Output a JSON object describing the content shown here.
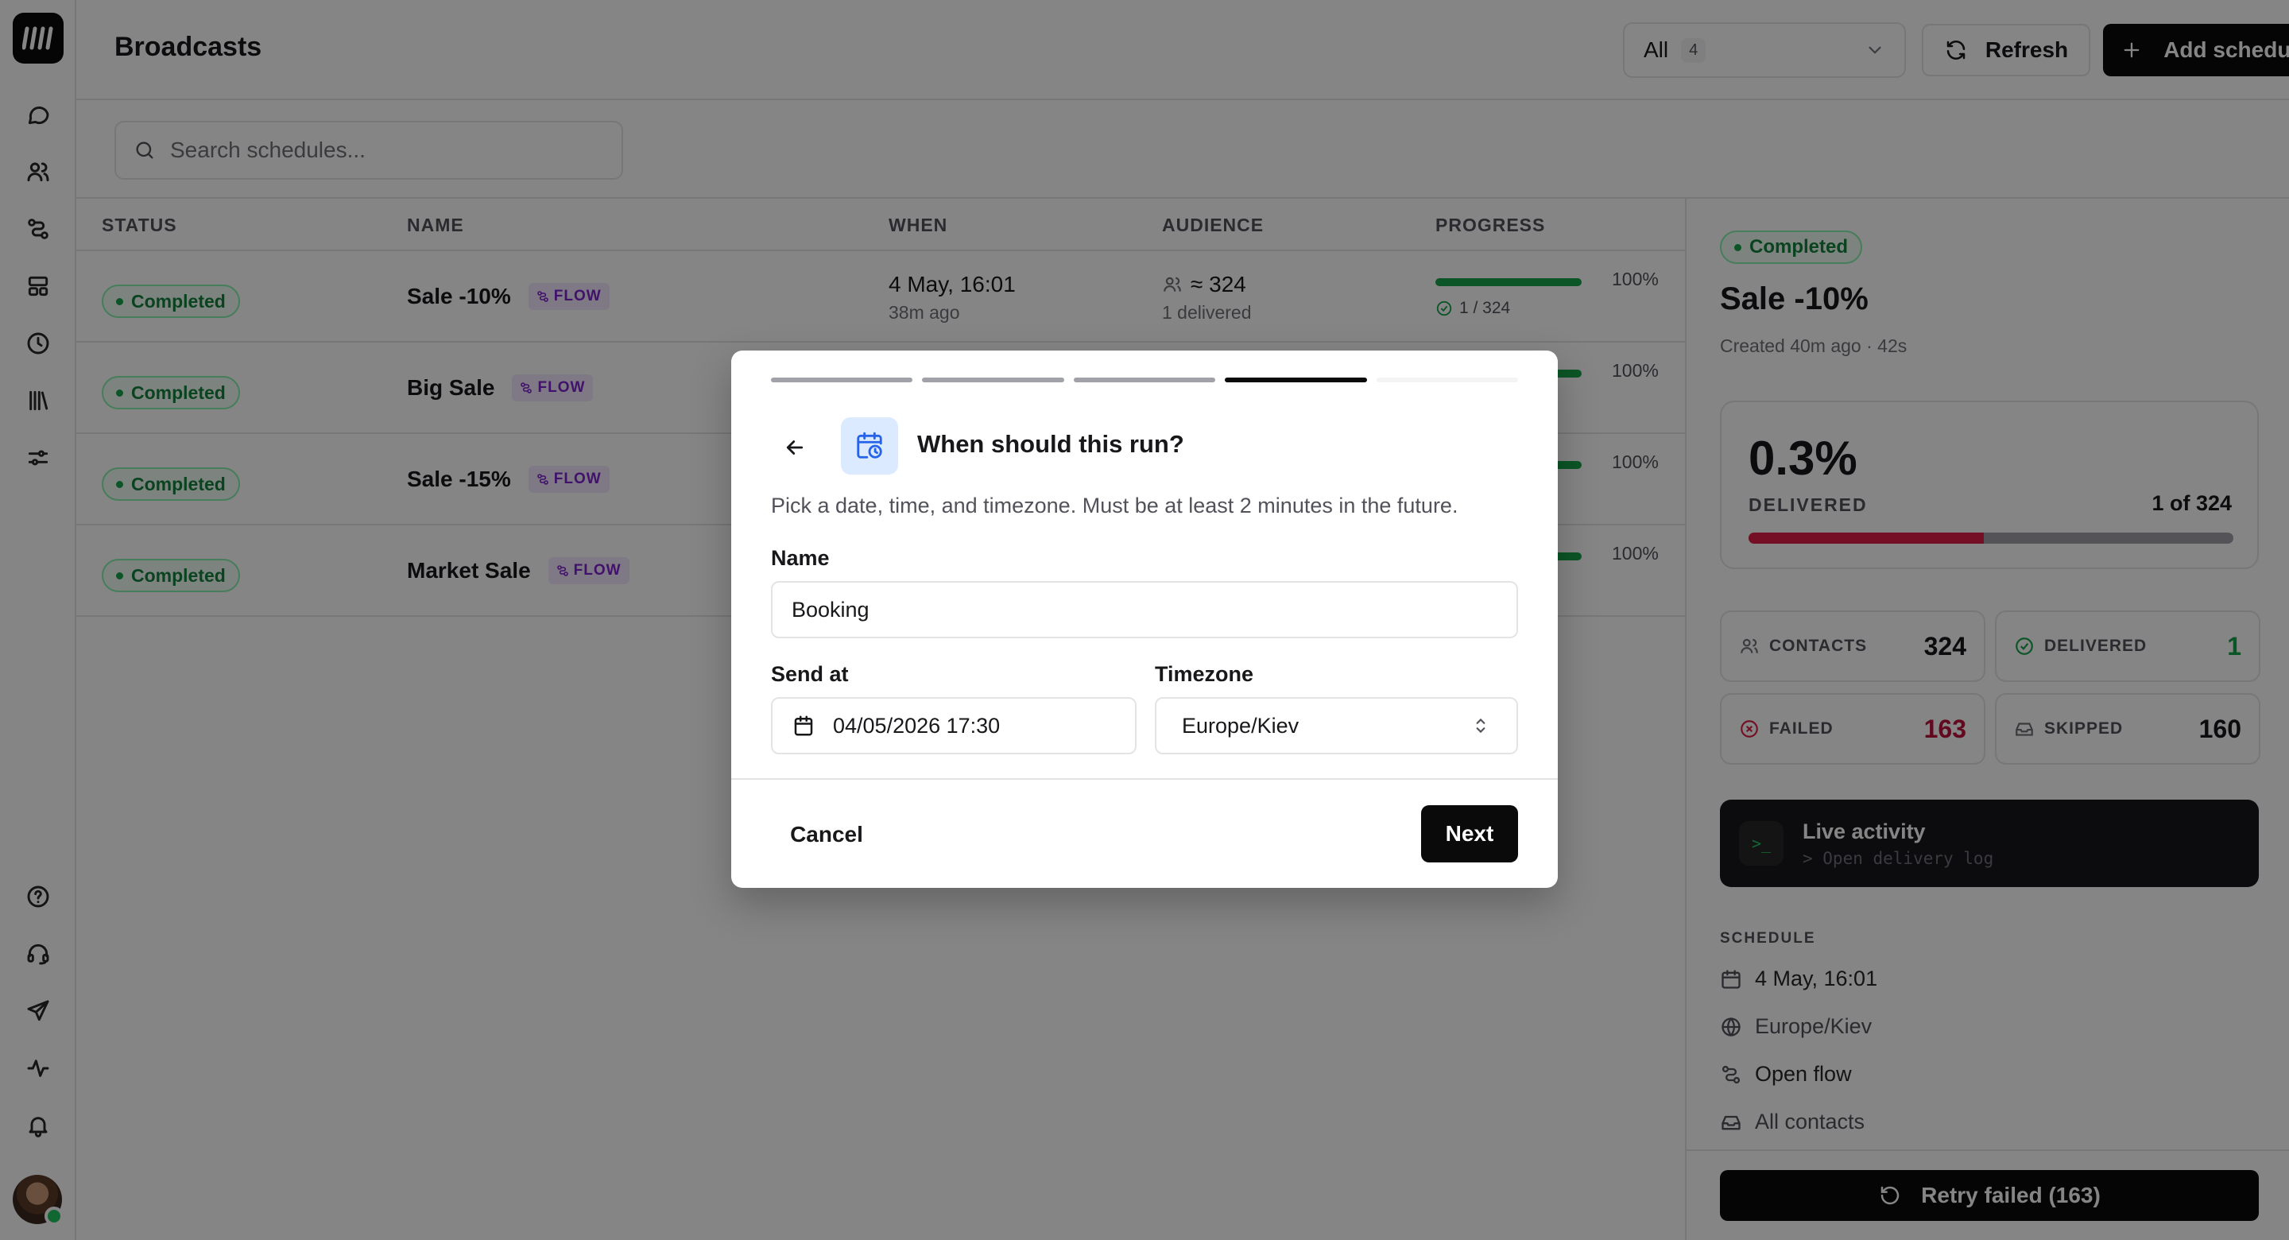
{
  "header": {
    "title": "Broadcasts",
    "filter_label": "All",
    "filter_count": "4",
    "refresh_label": "Refresh",
    "add_label": "Add schedule"
  },
  "search": {
    "placeholder": "Search schedules..."
  },
  "table": {
    "columns": [
      "STATUS",
      "NAME",
      "WHEN",
      "AUDIENCE",
      "PROGRESS"
    ],
    "rows": [
      {
        "status": "Completed",
        "name": "Sale -10%",
        "tag": "FLOW",
        "when": "4 May, 16:01",
        "when_sub": "38m ago",
        "audience": "≈ 324",
        "audience_sub": "1 delivered",
        "progress": 1.0,
        "progress_label": "100%",
        "progress_sub": "1 / 324"
      },
      {
        "status": "Completed",
        "name": "Big Sale",
        "tag": "FLOW",
        "progress": 1.0,
        "progress_label": "100%"
      },
      {
        "status": "Completed",
        "name": "Sale -15%",
        "tag": "FLOW",
        "progress": 1.0,
        "progress_label": "100%"
      },
      {
        "status": "Completed",
        "name": "Market Sale",
        "tag": "FLOW",
        "progress": 1.0,
        "progress_label": "100%"
      }
    ]
  },
  "panel": {
    "status": "Completed",
    "title": "Sale -10%",
    "created": "Created 40m ago · 42s",
    "rate": "0.3%",
    "rate_label": "DELIVERED",
    "rate_of": "1 of 324",
    "rate_fraction": 0.485,
    "stats": [
      {
        "label": "CONTACTS",
        "value": "324",
        "color": "#18181b"
      },
      {
        "label": "DELIVERED",
        "value": "1",
        "color": "#16a34a"
      },
      {
        "label": "FAILED",
        "value": "163",
        "color": "#be123c"
      },
      {
        "label": "SKIPPED",
        "value": "160",
        "color": "#18181b"
      }
    ],
    "live_title": "Live activity",
    "live_sub": "> Open delivery log",
    "schedule_heading": "SCHEDULE",
    "schedule_when": "4 May, 16:01",
    "schedule_tz": "Europe/Kiev",
    "schedule_flow": "Open flow",
    "schedule_audience": "All contacts",
    "retry_label": "Retry failed (163)"
  },
  "modal": {
    "steps_total": 5,
    "steps_done": 4,
    "title": "When should this run?",
    "description": "Pick a date, time, and timezone. Must be at least 2 minutes in the future.",
    "name_label": "Name",
    "name_value": "Booking",
    "send_label": "Send at",
    "send_value": "04/05/2026 17:30",
    "tz_label": "Timezone",
    "tz_value": "Europe/Kiev",
    "cancel_label": "Cancel",
    "next_label": "Next"
  },
  "colors": {
    "accent": "#0a0a0a",
    "success": "#16a34a",
    "danger": "#e11d48",
    "flow_tag": "#7e22ce"
  },
  "icons": [
    "logo-icon",
    "chat-icon",
    "users-icon",
    "flow-icon",
    "templates-icon",
    "clock-icon",
    "library-icon",
    "settings-icon",
    "help-icon",
    "support-icon",
    "send-icon",
    "activity-icon",
    "bell-icon"
  ]
}
